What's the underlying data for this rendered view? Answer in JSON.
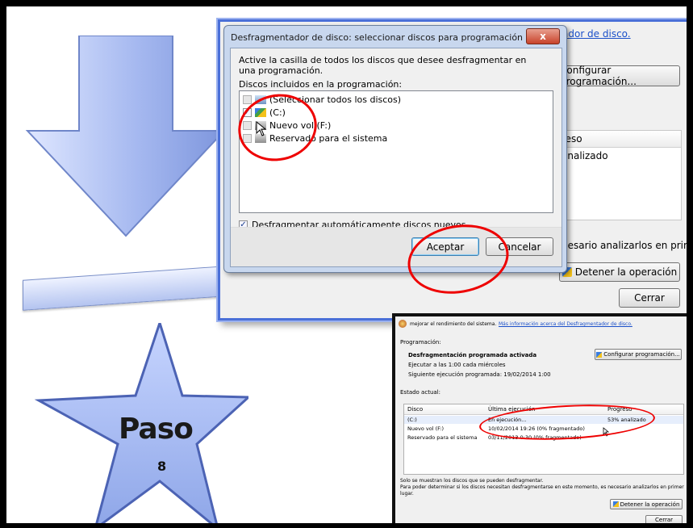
{
  "step": {
    "label": "Paso",
    "number": "8"
  },
  "dialog": {
    "title": "Desfragmentador de disco: seleccionar discos para programación",
    "close_glyph": "x",
    "instruction": "Active la casilla de todos los discos que desee desfragmentar en una programación.",
    "list_label": "Discos incluidos en la programación:",
    "items": [
      {
        "label": "(Seleccionar todos los discos)",
        "checked": false
      },
      {
        "label": "(C:)",
        "checked": true
      },
      {
        "label": "Nuevo vol (F:)",
        "checked": false
      },
      {
        "label": "Reservado para el sistema",
        "checked": false
      }
    ],
    "auto_label": "Desfragmentar automáticamente discos nuevos",
    "ok": "Aceptar",
    "cancel": "Cancelar"
  },
  "background_window": {
    "link": "ador de disco.",
    "configure": "Configurar programación...",
    "col_progress": "reso",
    "row_progress": "analizado",
    "note": "cesario analizarlos en primer",
    "stop": "Detener la operación",
    "close": "Cerrar"
  },
  "result_window": {
    "intro": "mejorar el rendimiento del sistema.",
    "intro_link": "Más información acerca del Desfragmentador de disco.",
    "schedule_heading": "Programación:",
    "schedule_status": "Desfragmentación programada activada",
    "schedule_run": "Ejecutar a las 1:00 cada miércoles",
    "schedule_next": "Siguiente ejecución programada: 19/02/2014 1:00",
    "configure": "Configurar programación...",
    "state_heading": "Estado actual:",
    "columns": [
      "Disco",
      "Última ejecución",
      "Progreso"
    ],
    "rows": [
      {
        "disk": "(C:)",
        "last": "En ejecución...",
        "progress": "53% analizado"
      },
      {
        "disk": "Nuevo vol (F:)",
        "last": "10/02/2014 19:26 (0% fragmentado)",
        "progress": ""
      },
      {
        "disk": "Reservado para el sistema",
        "last": "03/11/2013 0:30 (0% fragmentado)",
        "progress": ""
      }
    ],
    "note1": "Solo se muestran los discos que se pueden desfragmentar.",
    "note2": "Para poder determinar si los discos necesitan desfragmentarse en este momento, es necesario analizarlos en primer",
    "note3": "lugar.",
    "stop": "Detener la operación",
    "close": "Cerrar"
  },
  "colors": {
    "accent_red": "#e00000",
    "frame_blue": "#4a6fd8",
    "arrow_fill": "#9fb3ee",
    "star_fill": "#a9bdf2"
  }
}
